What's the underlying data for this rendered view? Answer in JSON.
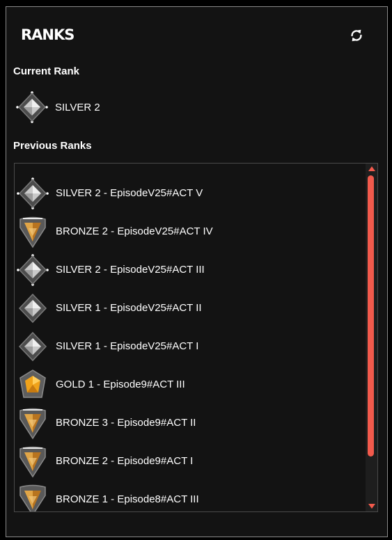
{
  "header": {
    "title": "RANKS",
    "refresh_icon": "refresh-icon"
  },
  "current": {
    "label": "Current Rank",
    "rank": {
      "text": "SILVER 2",
      "tier": "silver",
      "icon": "silver-rank-icon"
    }
  },
  "previous": {
    "label": "Previous Ranks",
    "items": [
      {
        "text": "SILVER 2 - EpisodeV25#ACT V",
        "tier": "silver",
        "icon": "silver-rank-icon"
      },
      {
        "text": "BRONZE 2 - EpisodeV25#ACT IV",
        "tier": "bronze",
        "icon": "bronze-rank-icon"
      },
      {
        "text": "SILVER 2 - EpisodeV25#ACT III",
        "tier": "silver",
        "icon": "silver-rank-icon"
      },
      {
        "text": "SILVER 1 - EpisodeV25#ACT II",
        "tier": "silver1",
        "icon": "silver-rank-icon"
      },
      {
        "text": "SILVER 1 - EpisodeV25#ACT I",
        "tier": "silver1",
        "icon": "silver-rank-icon"
      },
      {
        "text": "GOLD 1 - Episode9#ACT III",
        "tier": "gold",
        "icon": "gold-rank-icon"
      },
      {
        "text": "BRONZE 3 - Episode9#ACT II",
        "tier": "bronze",
        "icon": "bronze-rank-icon"
      },
      {
        "text": "BRONZE 2 - Episode9#ACT I",
        "tier": "bronze",
        "icon": "bronze-rank-icon"
      },
      {
        "text": "BRONZE 1 - Episode8#ACT III",
        "tier": "bronze1",
        "icon": "bronze-rank-icon"
      }
    ]
  },
  "colors": {
    "background": "#131313",
    "border": "#8a8a8a",
    "scrollbar_accent": "#f25a4c",
    "text": "#ffffff"
  }
}
